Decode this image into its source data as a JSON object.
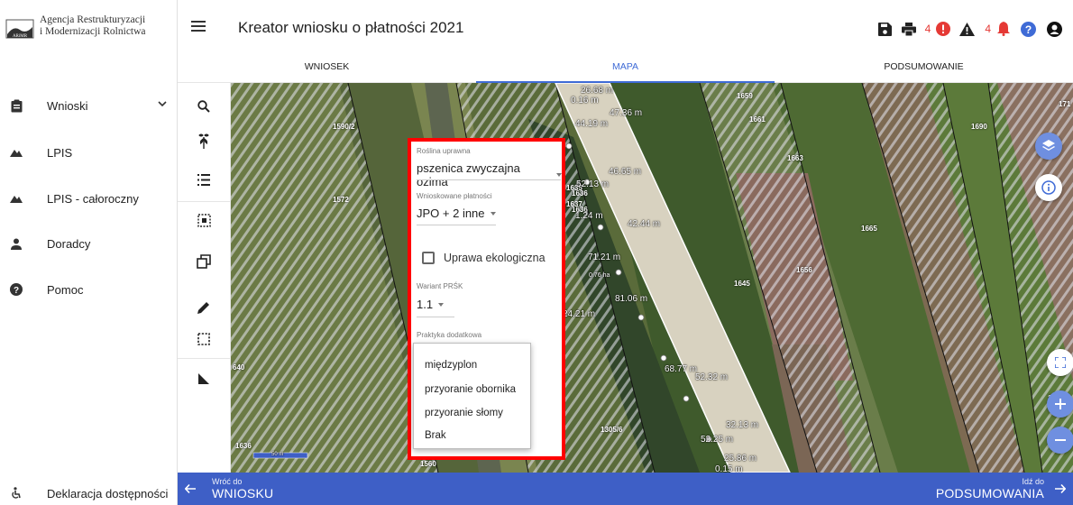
{
  "org": {
    "line1": "Agencja Restrukturyzacji",
    "line2": "i Modernizacji Rolnictwa",
    "logo_text": "ARiMR"
  },
  "sidebar": {
    "items": [
      {
        "label": "Wnioski",
        "icon": "clipboard-icon"
      },
      {
        "label": "LPIS",
        "icon": "mountain-icon"
      },
      {
        "label": "LPIS - całoroczny",
        "icon": "mountain-icon"
      },
      {
        "label": "Doradcy",
        "icon": "person-icon"
      },
      {
        "label": "Pomoc",
        "icon": "help-icon"
      }
    ],
    "accessibility": {
      "label": "Deklaracja dostępności",
      "icon": "accessibility-icon"
    }
  },
  "topbar": {
    "title": "Kreator wniosku o płatności 2021",
    "error_count": "4",
    "warning_count": "4"
  },
  "tabs": [
    {
      "label": "WNIOSEK"
    },
    {
      "label": "MAPA"
    },
    {
      "label": "PODSUMOWANIE"
    }
  ],
  "active_tab": "MAPA",
  "map": {
    "parcels": [
      "1590/2",
      "1572",
      "1659",
      "1661",
      "1663",
      "1690",
      "171",
      "1665",
      "1656",
      "1645",
      "1636",
      "1636",
      "1636",
      "1675",
      "1305/6",
      "1560",
      "640",
      "1635",
      "1637"
    ],
    "measurements": [
      "26.68 m",
      "0.16 m",
      "44.19 m",
      "47.36 m",
      "46.65 m",
      "52.13 m",
      "1.24 m",
      "42.44 m",
      "71.21 m",
      "0.76 ha",
      "81.06 m",
      "24.21 m",
      "68.77 m",
      "52.32 m",
      "32.13 m",
      "52.25 m",
      "25.86 m",
      "0.15 m"
    ],
    "scale": "50 m"
  },
  "popup": {
    "crop_label": "Roślina uprawna",
    "crop_value": "pszenica zwyczajna ozima",
    "payments_label": "Wnioskowane płatności",
    "payments_value": "JPO + 2 inne",
    "organic_label": "Uprawa ekologiczna",
    "organic_checked": false,
    "variant_label": "Wariant PRŚK",
    "variant_value": "1.1",
    "practice_label": "Praktyka dodatkowa",
    "practice_options": [
      "międzyplon",
      "przyoranie obornika",
      "przyoranie słomy",
      "Brak"
    ]
  },
  "bottombar": {
    "prev_small": "Wróć do",
    "prev_big": "WNIOSKU",
    "next_small": "Idź do",
    "next_big": "PODSUMOWANIA"
  },
  "colors": {
    "accent": "#3e5fc6",
    "tab_active": "#3f6bd6",
    "error": "#e53935",
    "highlight": "#ff0000",
    "fab_blue": "#6f8fe0"
  }
}
